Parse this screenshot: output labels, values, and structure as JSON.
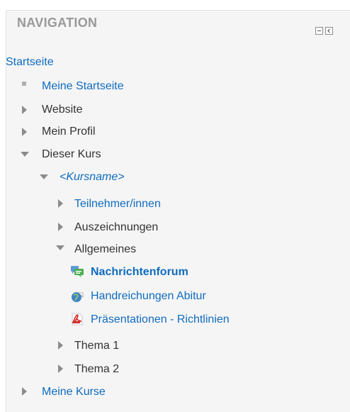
{
  "block": {
    "title": "NAVIGATION"
  },
  "nav": {
    "home": "Startseite",
    "my_home": "Meine Startseite",
    "website": "Website",
    "my_profile": "Mein Profil",
    "this_course": "Dieser Kurs",
    "course_name": "<Kursname>",
    "participants": "Teilnehmer/innen",
    "badges": "Auszeichnungen",
    "general": "Allgemeines",
    "forum": "Nachrichtenforum",
    "handouts": "Handreichungen Abitur",
    "presentations": "Präsentationen - Richtlinien",
    "topic1": "Thema 1",
    "topic2": "Thema 2",
    "my_courses": "Meine Kurse"
  },
  "icons": {
    "forum": "forum-icon",
    "handouts": "url-resource-icon",
    "presentations": "pdf-icon"
  },
  "colors": {
    "link": "#0f6cbf",
    "text": "#333333",
    "header": "#999999",
    "background": "#f5f5f5"
  }
}
